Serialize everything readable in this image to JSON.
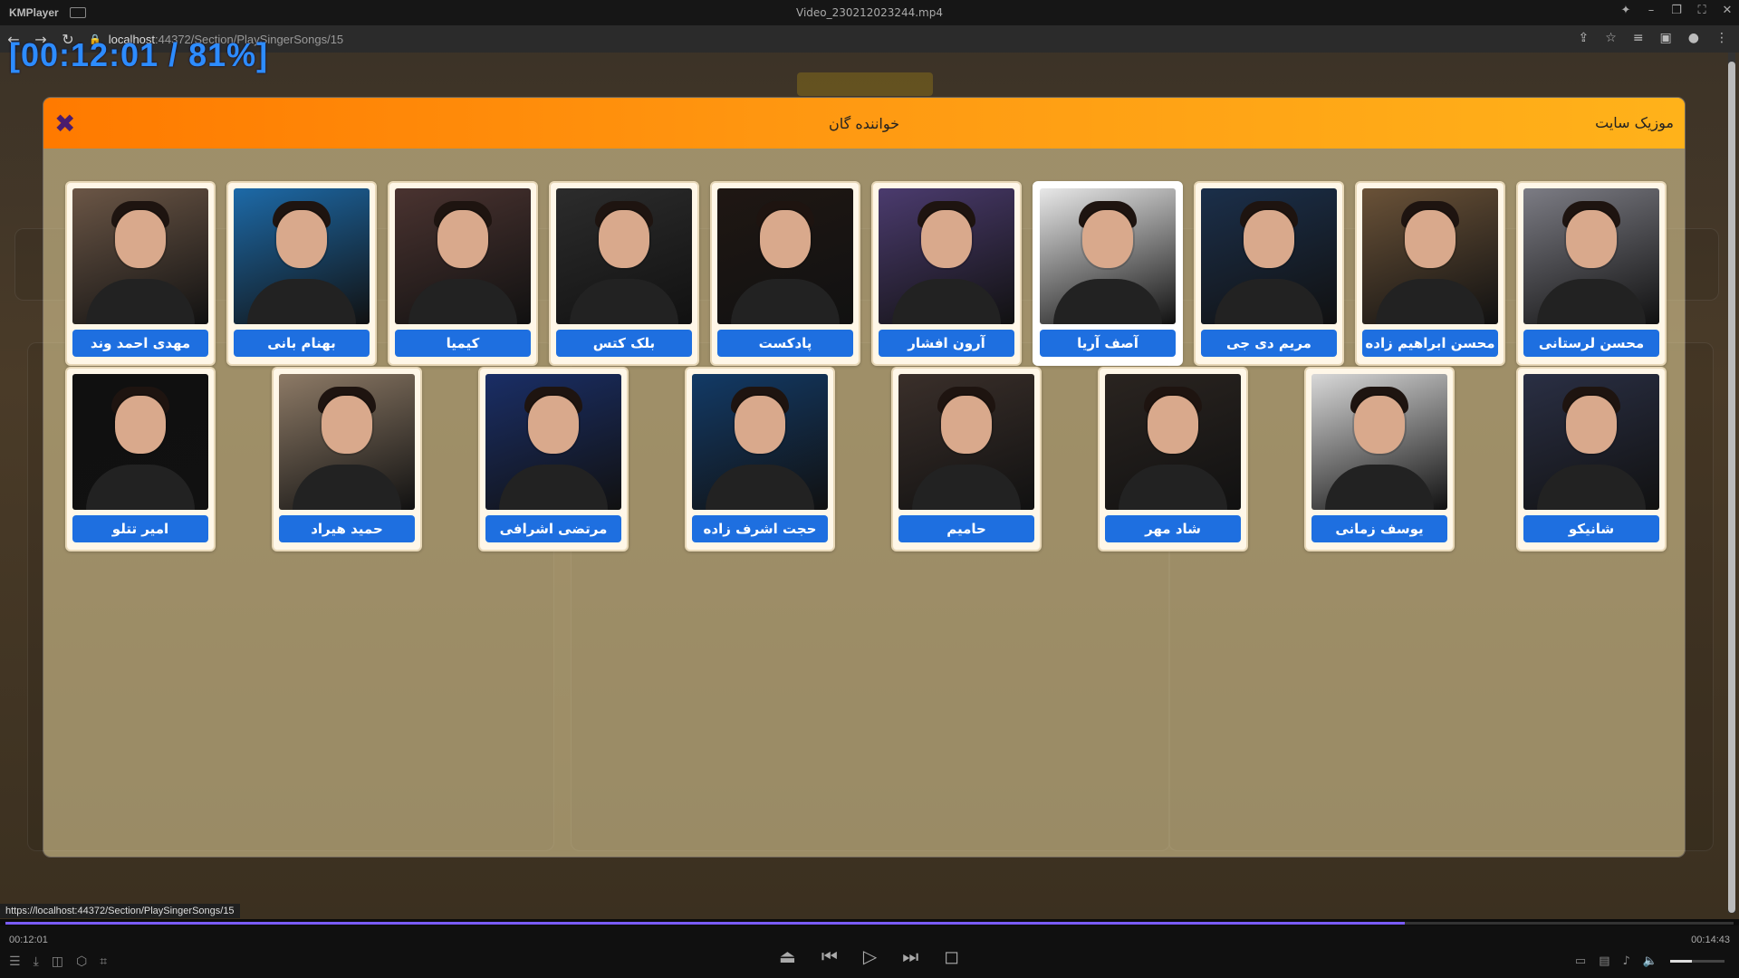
{
  "player": {
    "app_name": "KMPlayer",
    "file_name": "Video_230212023244.mp4",
    "osd_text": "[00:12:01 / 81%]",
    "time_current": "00:12:01",
    "time_total": "00:14:43",
    "progress_fraction": 0.81,
    "volume_fraction": 0.4
  },
  "browser": {
    "host": "localhost",
    "path": ":44372/Section/PlaySingerSongs/15",
    "status_url": "https://localhost:44372/Section/PlaySingerSongs/15"
  },
  "modal": {
    "title": "خواننده گان",
    "site_label": "موزیک سایت",
    "close_glyph": "✖",
    "rows": [
      [
        {
          "name": "مهدی احمد وند",
          "color": "#6b5646"
        },
        {
          "name": "بهنام بانی",
          "color": "#1d6aa8"
        },
        {
          "name": "کیمیا",
          "color": "#4a3330"
        },
        {
          "name": "بلک کتس",
          "color": "#2c2c2c"
        },
        {
          "name": "پادکست",
          "color": "#1f1713"
        },
        {
          "name": "آرون افشار",
          "color": "#4b3b6e"
        },
        {
          "name": "آصف آریا",
          "color": "#e8e8e8"
        },
        {
          "name": "مریم دی جی",
          "color": "#1b2f4a"
        },
        {
          "name": "محسن ابراهیم زاده",
          "color": "#6a5238"
        },
        {
          "name": "محسن لرستانی",
          "color": "#7c7c84"
        }
      ],
      [
        {
          "name": "امیر تتلو",
          "color": "#101010"
        },
        {
          "name": "حمید هیراد",
          "color": "#8d7a66"
        },
        {
          "name": "مرتضی اشرافی",
          "color": "#1a2e66"
        },
        {
          "name": "حجت اشرف زاده",
          "color": "#123a66"
        },
        {
          "name": "حامیم",
          "color": "#3a2f2a"
        },
        {
          "name": "شاد مهر",
          "color": "#2a2420"
        },
        {
          "name": "یوسف زمانی",
          "color": "#d8d8d8"
        },
        {
          "name": "شانیکو",
          "color": "#2a2f44"
        }
      ]
    ]
  }
}
